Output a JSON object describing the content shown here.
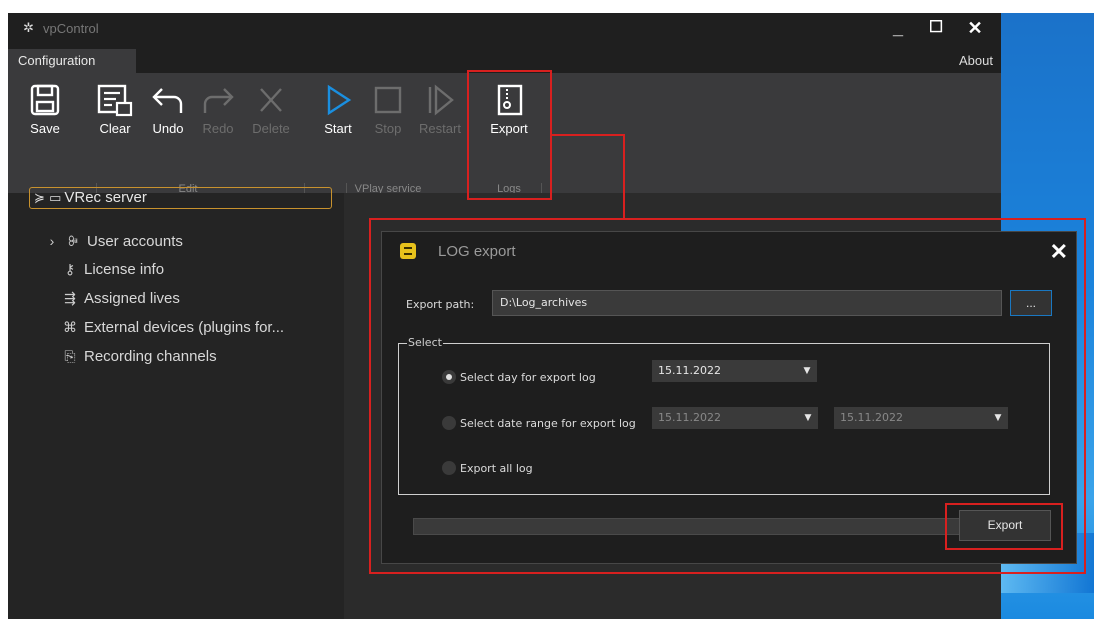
{
  "window": {
    "title": "vpControl",
    "app_icon": "gear-icon"
  },
  "tabs": {
    "active": "Configuration",
    "about": "About"
  },
  "ribbon": {
    "edit": {
      "save": "Save",
      "clear": "Clear",
      "undo": "Undo",
      "redo": "Redo",
      "delete": "Delete",
      "group": "Edit"
    },
    "vplay": {
      "start": "Start",
      "stop": "Stop",
      "restart": "Restart",
      "group": "VPlay service"
    },
    "logs": {
      "export": "Export",
      "group": "Logs"
    }
  },
  "tree": {
    "root": "VRec server",
    "items": [
      {
        "label": "User accounts",
        "icon": "users-icon"
      },
      {
        "label": "License info",
        "icon": "key-icon"
      },
      {
        "label": "Assigned lives",
        "icon": "assign-icon"
      },
      {
        "label": "External devices (plugins for...",
        "icon": "plugin-icon"
      },
      {
        "label": "Recording channels",
        "icon": "channel-icon"
      }
    ]
  },
  "dialog": {
    "title": "LOG export",
    "export_path_label": "Export path:",
    "export_path_value": "D:\\Log_archives",
    "browse_label": "...",
    "select_legend": "Select",
    "option_day": "Select day for export log",
    "option_range": "Select date range for export log",
    "option_all": "Export all log",
    "day_date": "15.11.2022",
    "range_from": "15.11.2022",
    "range_to": "15.11.2022",
    "export_button": "Export",
    "selected_option": "day"
  },
  "colors": {
    "highlight": "#d8201f",
    "accent": "#1a78c2",
    "tree_focus": "#c8922e"
  }
}
